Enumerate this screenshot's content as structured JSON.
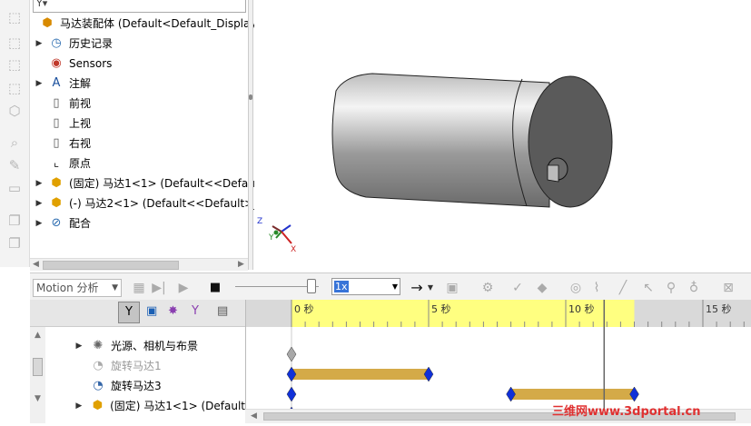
{
  "feature_tree": {
    "items": [
      {
        "label": "马达装配体  (Default<Default_Display",
        "icon": "assembly-icon",
        "expandable": false
      },
      {
        "label": "历史记录",
        "icon": "history-folder-icon",
        "expandable": true
      },
      {
        "label": "Sensors",
        "icon": "sensor-icon",
        "expandable": false
      },
      {
        "label": "注解",
        "icon": "annotation-icon",
        "expandable": true
      },
      {
        "label": "前视",
        "icon": "plane-icon",
        "expandable": false
      },
      {
        "label": "上视",
        "icon": "plane-icon",
        "expandable": false
      },
      {
        "label": "右视",
        "icon": "plane-icon",
        "expandable": false
      },
      {
        "label": "原点",
        "icon": "origin-icon",
        "expandable": false
      },
      {
        "label": "(固定) 马达1<1> (Default<<Defau",
        "icon": "part-icon",
        "expandable": true
      },
      {
        "label": "(-) 马达2<1> (Default<<Default>_",
        "icon": "part-icon",
        "expandable": true
      },
      {
        "label": "配合",
        "icon": "mates-icon",
        "expandable": true
      }
    ]
  },
  "motion_toolbar": {
    "study_type": "Motion 分析",
    "playback_speed": "1x"
  },
  "motion_tree": {
    "rows": [
      {
        "label": "光源、相机与布景",
        "dimmed": false,
        "expandable": true,
        "icon": "lights-icon"
      },
      {
        "label": "旋转马达1",
        "dimmed": true,
        "expandable": false,
        "icon": "rotary-motor-icon"
      },
      {
        "label": "旋转马达3",
        "dimmed": false,
        "expandable": false,
        "icon": "rotary-motor-icon"
      },
      {
        "label": "(固定) 马达1<1> (Default",
        "dimmed": false,
        "expandable": true,
        "icon": "part-icon"
      }
    ]
  },
  "timeline": {
    "ticks": [
      {
        "t": 0,
        "label": "0 秒"
      },
      {
        "t": 5,
        "label": "5 秒"
      },
      {
        "t": 10,
        "label": "10 秒"
      },
      {
        "t": 15,
        "label": "15 秒"
      }
    ],
    "study_duration_s": 12.5,
    "current_time_s": 11.4,
    "bars": [
      {
        "row": 1,
        "start": 0,
        "end": 5
      },
      {
        "row": 2,
        "start": 8,
        "end": 12.5
      }
    ],
    "keys": [
      {
        "row": 0,
        "t": 0,
        "color": "#a8a8a8"
      },
      {
        "row": 1,
        "t": 0,
        "color": "#1030d8"
      },
      {
        "row": 1,
        "t": 5,
        "color": "#1030d8"
      },
      {
        "row": 2,
        "t": 0,
        "color": "#1030d8"
      },
      {
        "row": 2,
        "t": 8,
        "color": "#1030d8"
      },
      {
        "row": 2,
        "t": 12.5,
        "color": "#1030d8"
      },
      {
        "row": 3,
        "t": 0,
        "color": "#1030d8"
      }
    ],
    "colors": {
      "highlight": "#ffff80",
      "bar": "#d4aa48",
      "key": "#1030d8"
    }
  },
  "triad": {
    "x": "X",
    "y": "Y",
    "z": "Z"
  },
  "watermark": "三维网www.3dportal.cn"
}
